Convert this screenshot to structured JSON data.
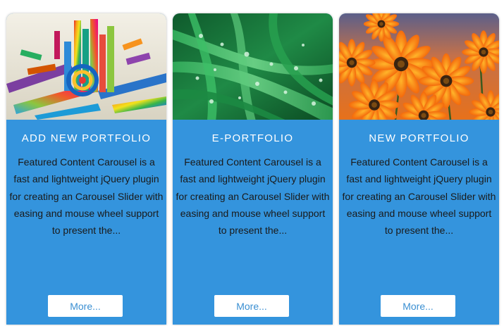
{
  "cards": [
    {
      "title": "ADD NEW PORTFOLIO",
      "image": "abstract-3d-colorful-art",
      "description": "Featured Content Carousel is a fast and lightweight jQuery plugin for creating an Carousel Slider with easing and mouse wheel support to present the...",
      "button_label": "More..."
    },
    {
      "title": "E-PORTFOLIO",
      "image": "green-grass-water-drops",
      "description": "Featured Content Carousel is a fast and lightweight jQuery plugin for creating an Carousel Slider with easing and mouse wheel support to present the...",
      "button_label": "More..."
    },
    {
      "title": "NEW PORTFOLIO",
      "image": "orange-daisy-flowers",
      "description": "Featured Content Carousel is a fast and lightweight jQuery plugin for creating an Carousel Slider with easing and mouse wheel support to present the...",
      "button_label": "More..."
    }
  ],
  "colors": {
    "card_background": "#3494dd",
    "title_text": "#ffffff",
    "description_text": "#1a1a1a",
    "button_background": "#ffffff",
    "button_text": "#3a8fd2"
  }
}
